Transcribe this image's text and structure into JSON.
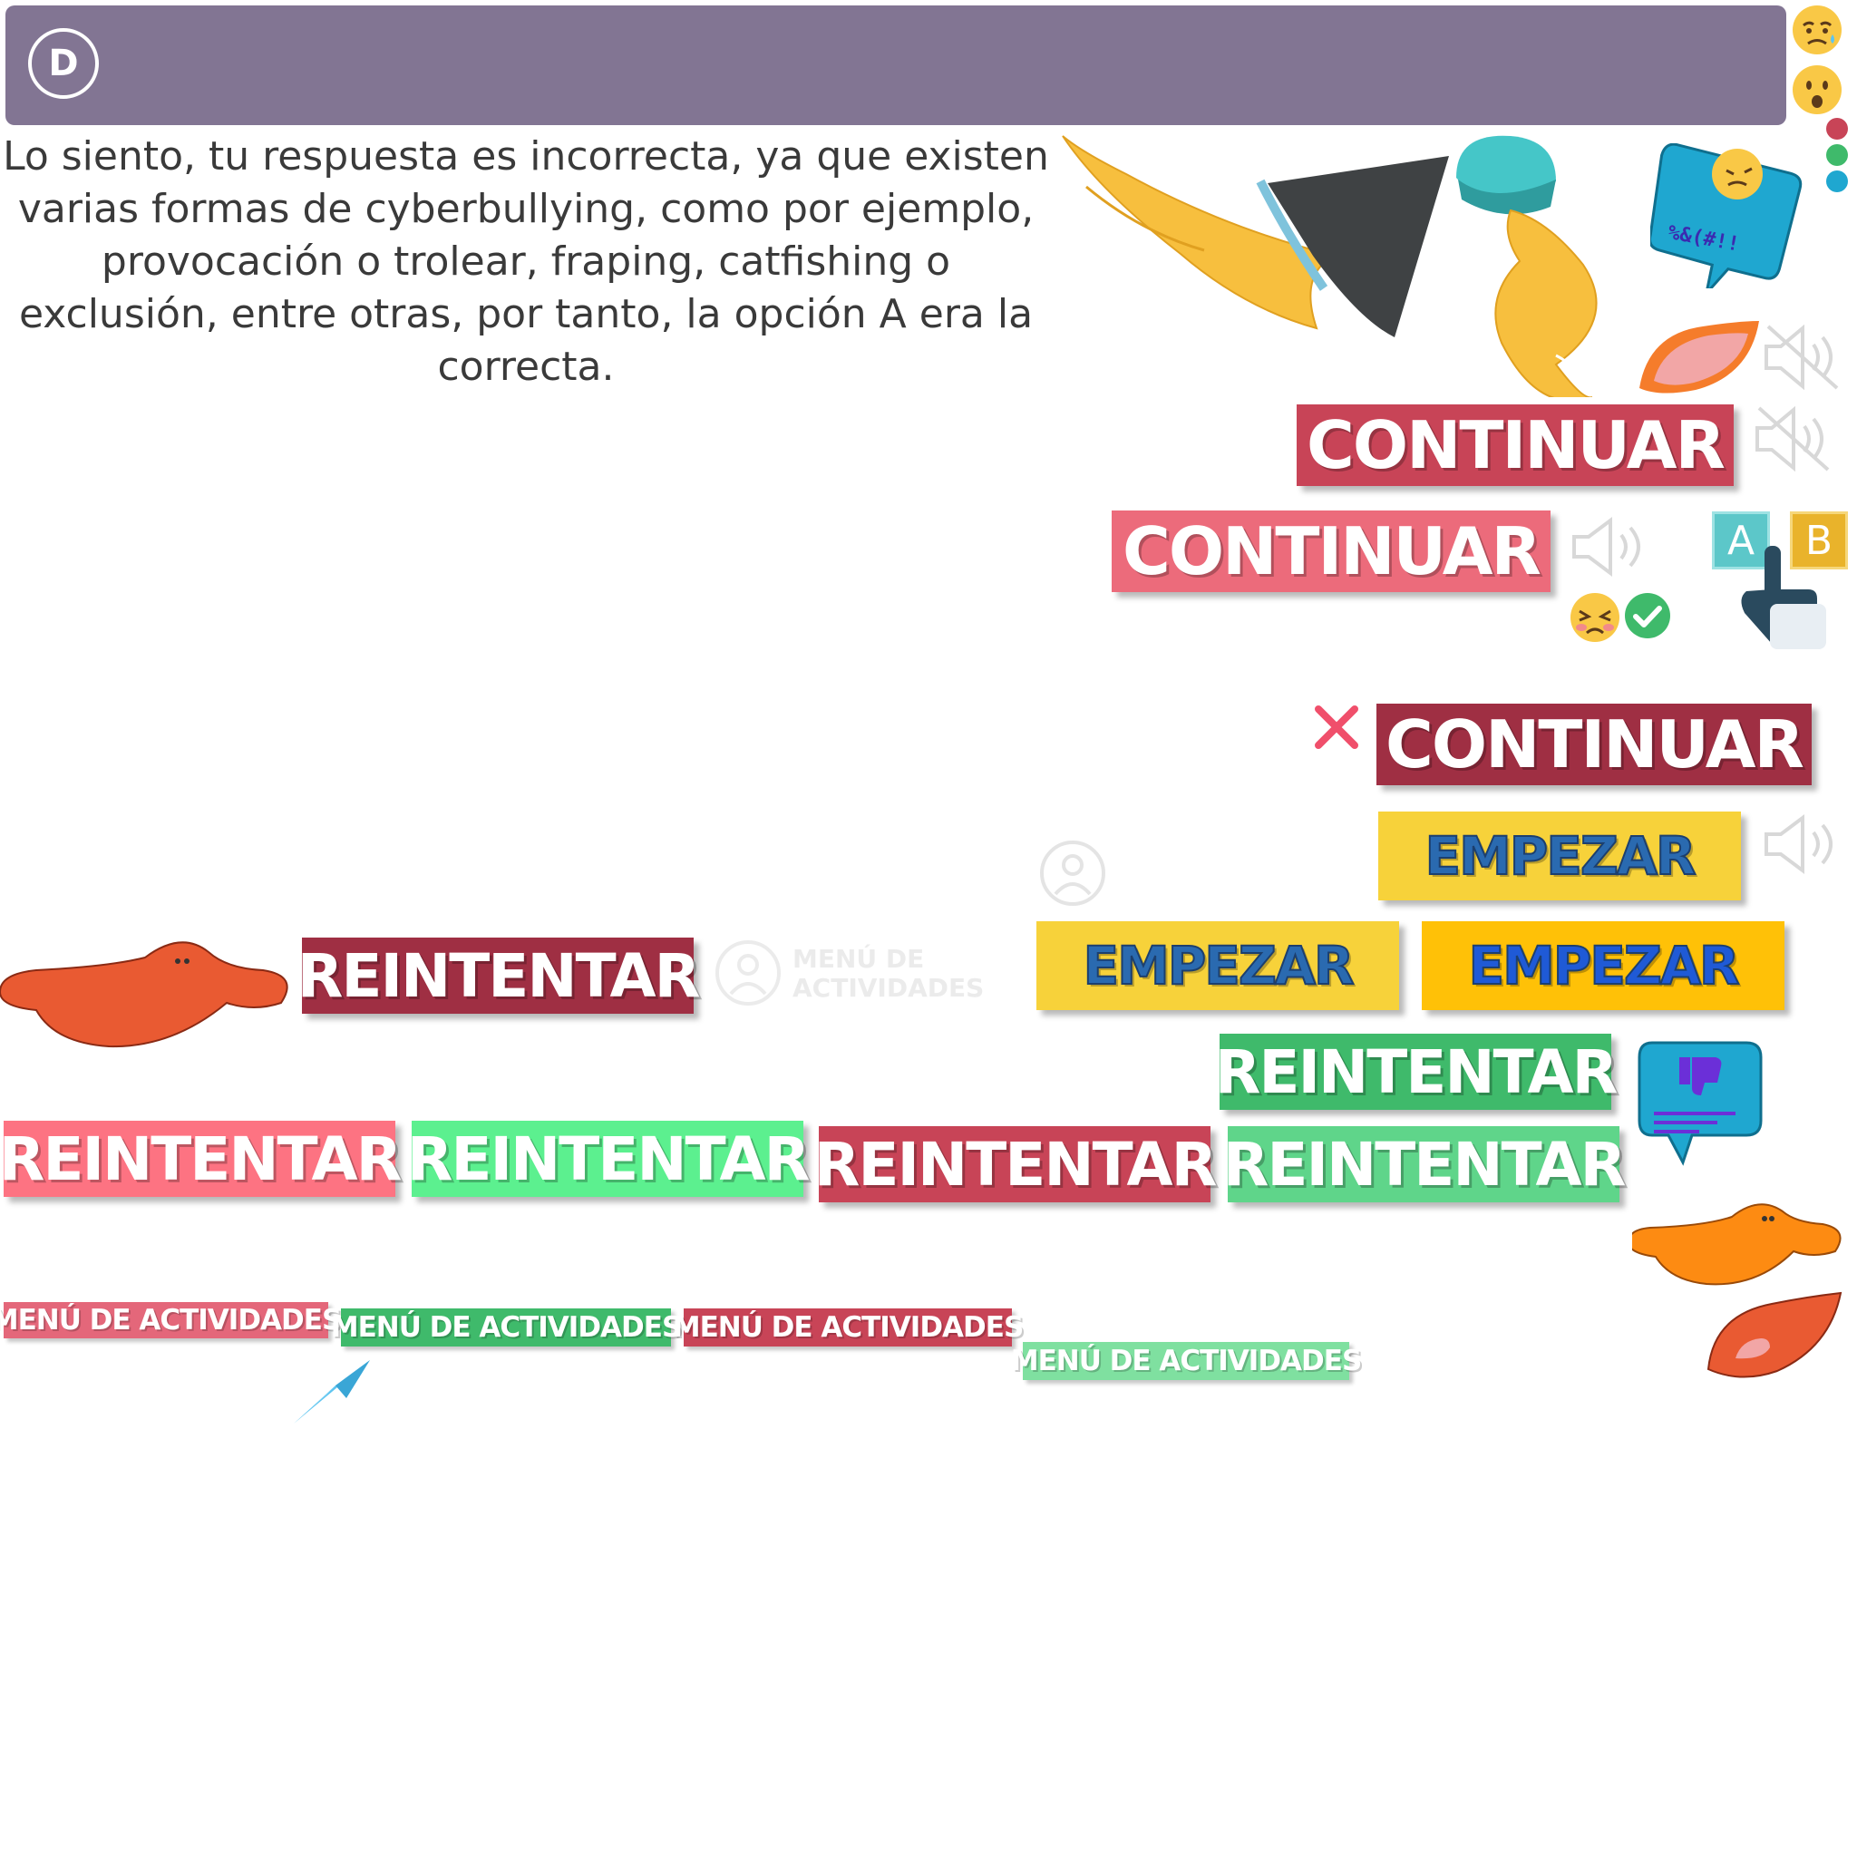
{
  "header": {
    "option_letter": "D",
    "bar_color": "#827593"
  },
  "feedback": {
    "text": "Lo siento, tu respuesta es incorrecta, ya que existen varias formas de cyberbullying, como por ejemplo, provocación o trolear, fraping, catfishing o exclusión, entre otras, por tanto, la opción A era la correcta."
  },
  "buttons": {
    "continuar_1": "CONTINUAR",
    "continuar_2": "CONTINUAR",
    "continuar_3": "CONTINUAR",
    "empezar_1": "EMPEZAR",
    "empezar_2": "EMPEZAR",
    "empezar_3": "EMPEZAR",
    "reintentar_1": "REINTENTAR",
    "reintentar_2": "REINTENTAR",
    "reintentar_3": "REINTENTAR",
    "reintentar_4": "REINTENTAR",
    "reintentar_5": "REINTENTAR",
    "reintentar_6": "REINTENTAR",
    "menu_1": "MENÚ DE ACTIVIDADES",
    "menu_2": "MENÚ DE ACTIVIDADES",
    "menu_3": "MENÚ DE ACTIVIDADES",
    "menu_4": "MENÚ DE ACTIVIDADES"
  },
  "menu_icon_ghost_label": "MENÚ DE ACTIVIDADES",
  "ab_keys": {
    "a": "A",
    "b": "B"
  },
  "speech_bubble_text": "%&(#!!",
  "colors": {
    "crimson": "#c84457",
    "pink": "#ec6b7b",
    "maroon": "#9f2f43",
    "yellow": "#f7d23a",
    "gold": "#ffc107",
    "green": "#3fba6b",
    "mint": "#5cf08f",
    "light_green": "#5fd58a"
  },
  "icons": [
    "worried-emoji-icon",
    "surprised-emoji-icon",
    "status-dots-icon",
    "angel-wing-icon",
    "leg-icon",
    "angry-speech-bubble-icon",
    "mute-icon",
    "speaker-icon",
    "ab-choice-hand-icon",
    "upset-emoji-icon",
    "check-icon",
    "close-icon",
    "menu-activities-icon",
    "tongue-shape-icon",
    "dislike-bubble-icon",
    "paper-plane-icon"
  ]
}
